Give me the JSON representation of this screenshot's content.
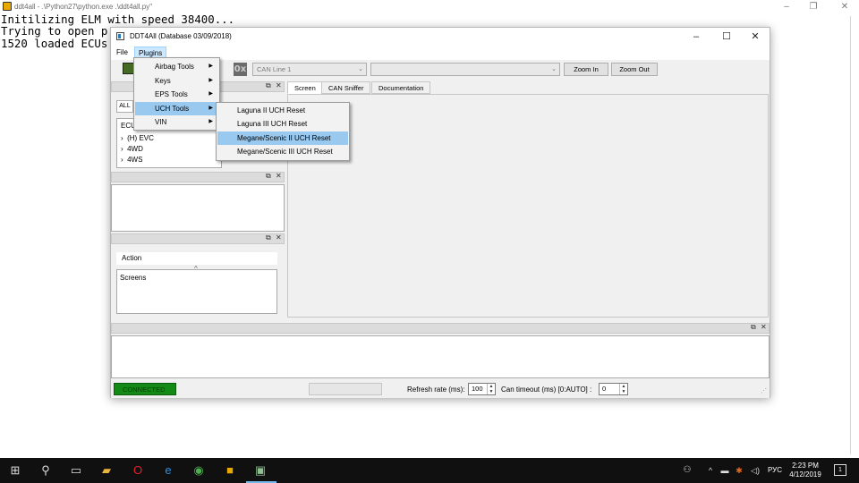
{
  "console": {
    "title": "ddt4all - .\\Python27\\python.exe .\\ddt4all.py\"",
    "lines": [
      "Initilizing ELM with speed 38400...",
      "Trying to open p",
      "1520 loaded ECUs"
    ]
  },
  "app": {
    "title": "DDT4All (Database 03/09/2018)",
    "menu": {
      "file": "File",
      "plugins": "Plugins"
    },
    "toolbar": {
      "can_line": "CAN Line 1",
      "zoom_in": "Zoom In",
      "zoom_out": "Zoom Out"
    },
    "ecu_panel": {
      "filter": "ALL",
      "tree_header": "ECU",
      "items": [
        "(H) EVC",
        "4WD",
        "4WS"
      ]
    },
    "tabs": [
      "Screen",
      "CAN Sniffer",
      "Documentation"
    ],
    "action_header": "Action",
    "screens_label": "Screens",
    "status": {
      "connected": "CONNECTED",
      "refresh_label": "Refresh rate (ms):",
      "refresh_value": "100",
      "timeout_label": "Can timeout (ms) [0:AUTO] :",
      "timeout_value": "0"
    }
  },
  "plugins_menu": {
    "items": [
      "Airbag Tools",
      "Keys",
      "EPS Tools",
      "UCH Tools",
      "VIN"
    ],
    "highlighted": "UCH Tools"
  },
  "uch_submenu": {
    "items": [
      "Laguna II UCH Reset",
      "Laguna III UCH Reset",
      "Megane/Scenic II UCH Reset",
      "Megane/Scenic III UCH Reset"
    ],
    "highlighted": "Megane/Scenic II UCH Reset"
  },
  "taskbar": {
    "lang": "РУС",
    "time": "2:23 PM",
    "date": "4/12/2019",
    "notifications": "1"
  }
}
